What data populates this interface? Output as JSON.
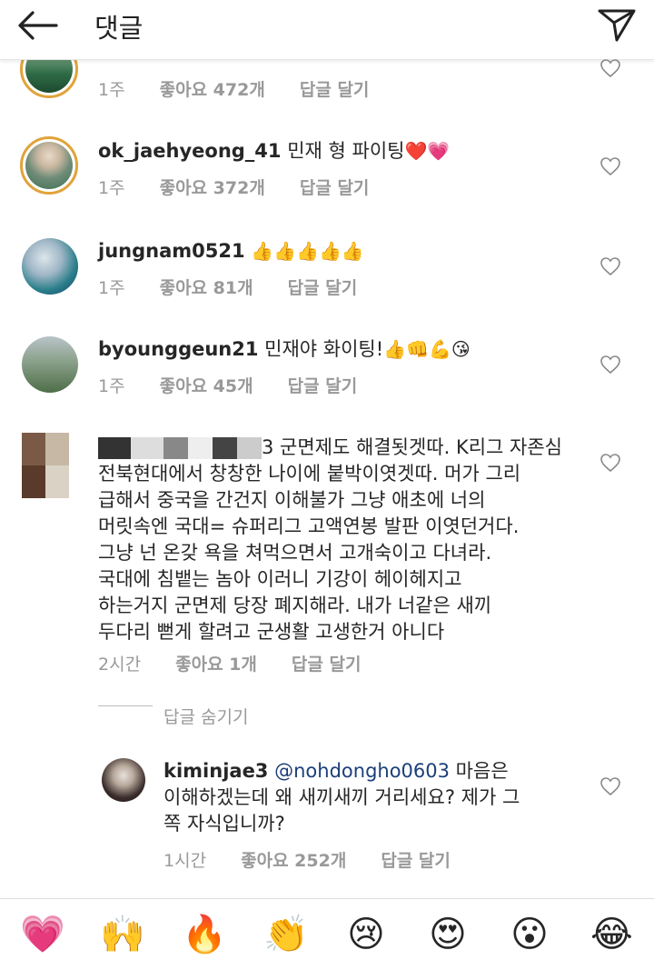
{
  "header": {
    "title": "댓글"
  },
  "comments": [
    {
      "username": "",
      "text": "",
      "age": "1주",
      "likes": "좋아요 472개",
      "reply": "답글 달기"
    },
    {
      "username": "ok_jaehyeong_41",
      "text": " 민재 형 파이팅",
      "emoji": "❤️💗",
      "age": "1주",
      "likes": "좋아요 372개",
      "reply": "답글 달기"
    },
    {
      "username": "jungnam0521",
      "text": " ",
      "emoji": "👍👍👍👍👍",
      "age": "1주",
      "likes": "좋아요 81개",
      "reply": "답글 달기"
    },
    {
      "username": "byounggeun21",
      "text": " 민재야 화이팅!",
      "emoji": "👍👊💪😘",
      "age": "1주",
      "likes": "좋아요 45개",
      "reply": "답글 달기"
    },
    {
      "username_suffix": "3",
      "lines": [
        "3 군면제도 해결됫겟따. K리그 자존심",
        "전북현대에서 창창한 나이에 붙박이엿겟따. 머가 그리",
        "급해서 중국을 간건지 이해불가 그냥 애초에 너의",
        "머릿속엔 국대= 슈퍼리그 고액연봉 발판 이엿던거다.",
        "그냥 넌 온갖 욕을 쳐먹으면서 고개숙이고 다녀라.",
        "국대에 침뱉는 놈아 이러니 기강이 헤이헤지고",
        "하는거지 군면제 당장 폐지해라. 내가 너같은 새끼",
        "두다리 뻗게 할려고 군생활 고생한거 아니다"
      ],
      "age": "2시간",
      "likes": "좋아요 1개",
      "reply": "답글 달기"
    }
  ],
  "reply_toggle": "답글 숨기기",
  "reply": {
    "username": "kiminjae3",
    "mention": "@nohdongho0603",
    "lines": [
      " 마음은",
      "이해하겠는데 왜 새끼새끼 거리세요? 제가 그",
      "쪽 자식입니까?"
    ],
    "age": "1시간",
    "likes": "좋아요 252개",
    "reply": "답글 달기"
  },
  "emoji_bar": [
    "💗",
    "🙌",
    "🔥",
    "👏",
    "😢",
    "😍",
    "😮",
    "😂"
  ],
  "colors": {
    "heart": "#e8406e",
    "ring": "#e0a33a",
    "mention": "#1b3f7a"
  }
}
